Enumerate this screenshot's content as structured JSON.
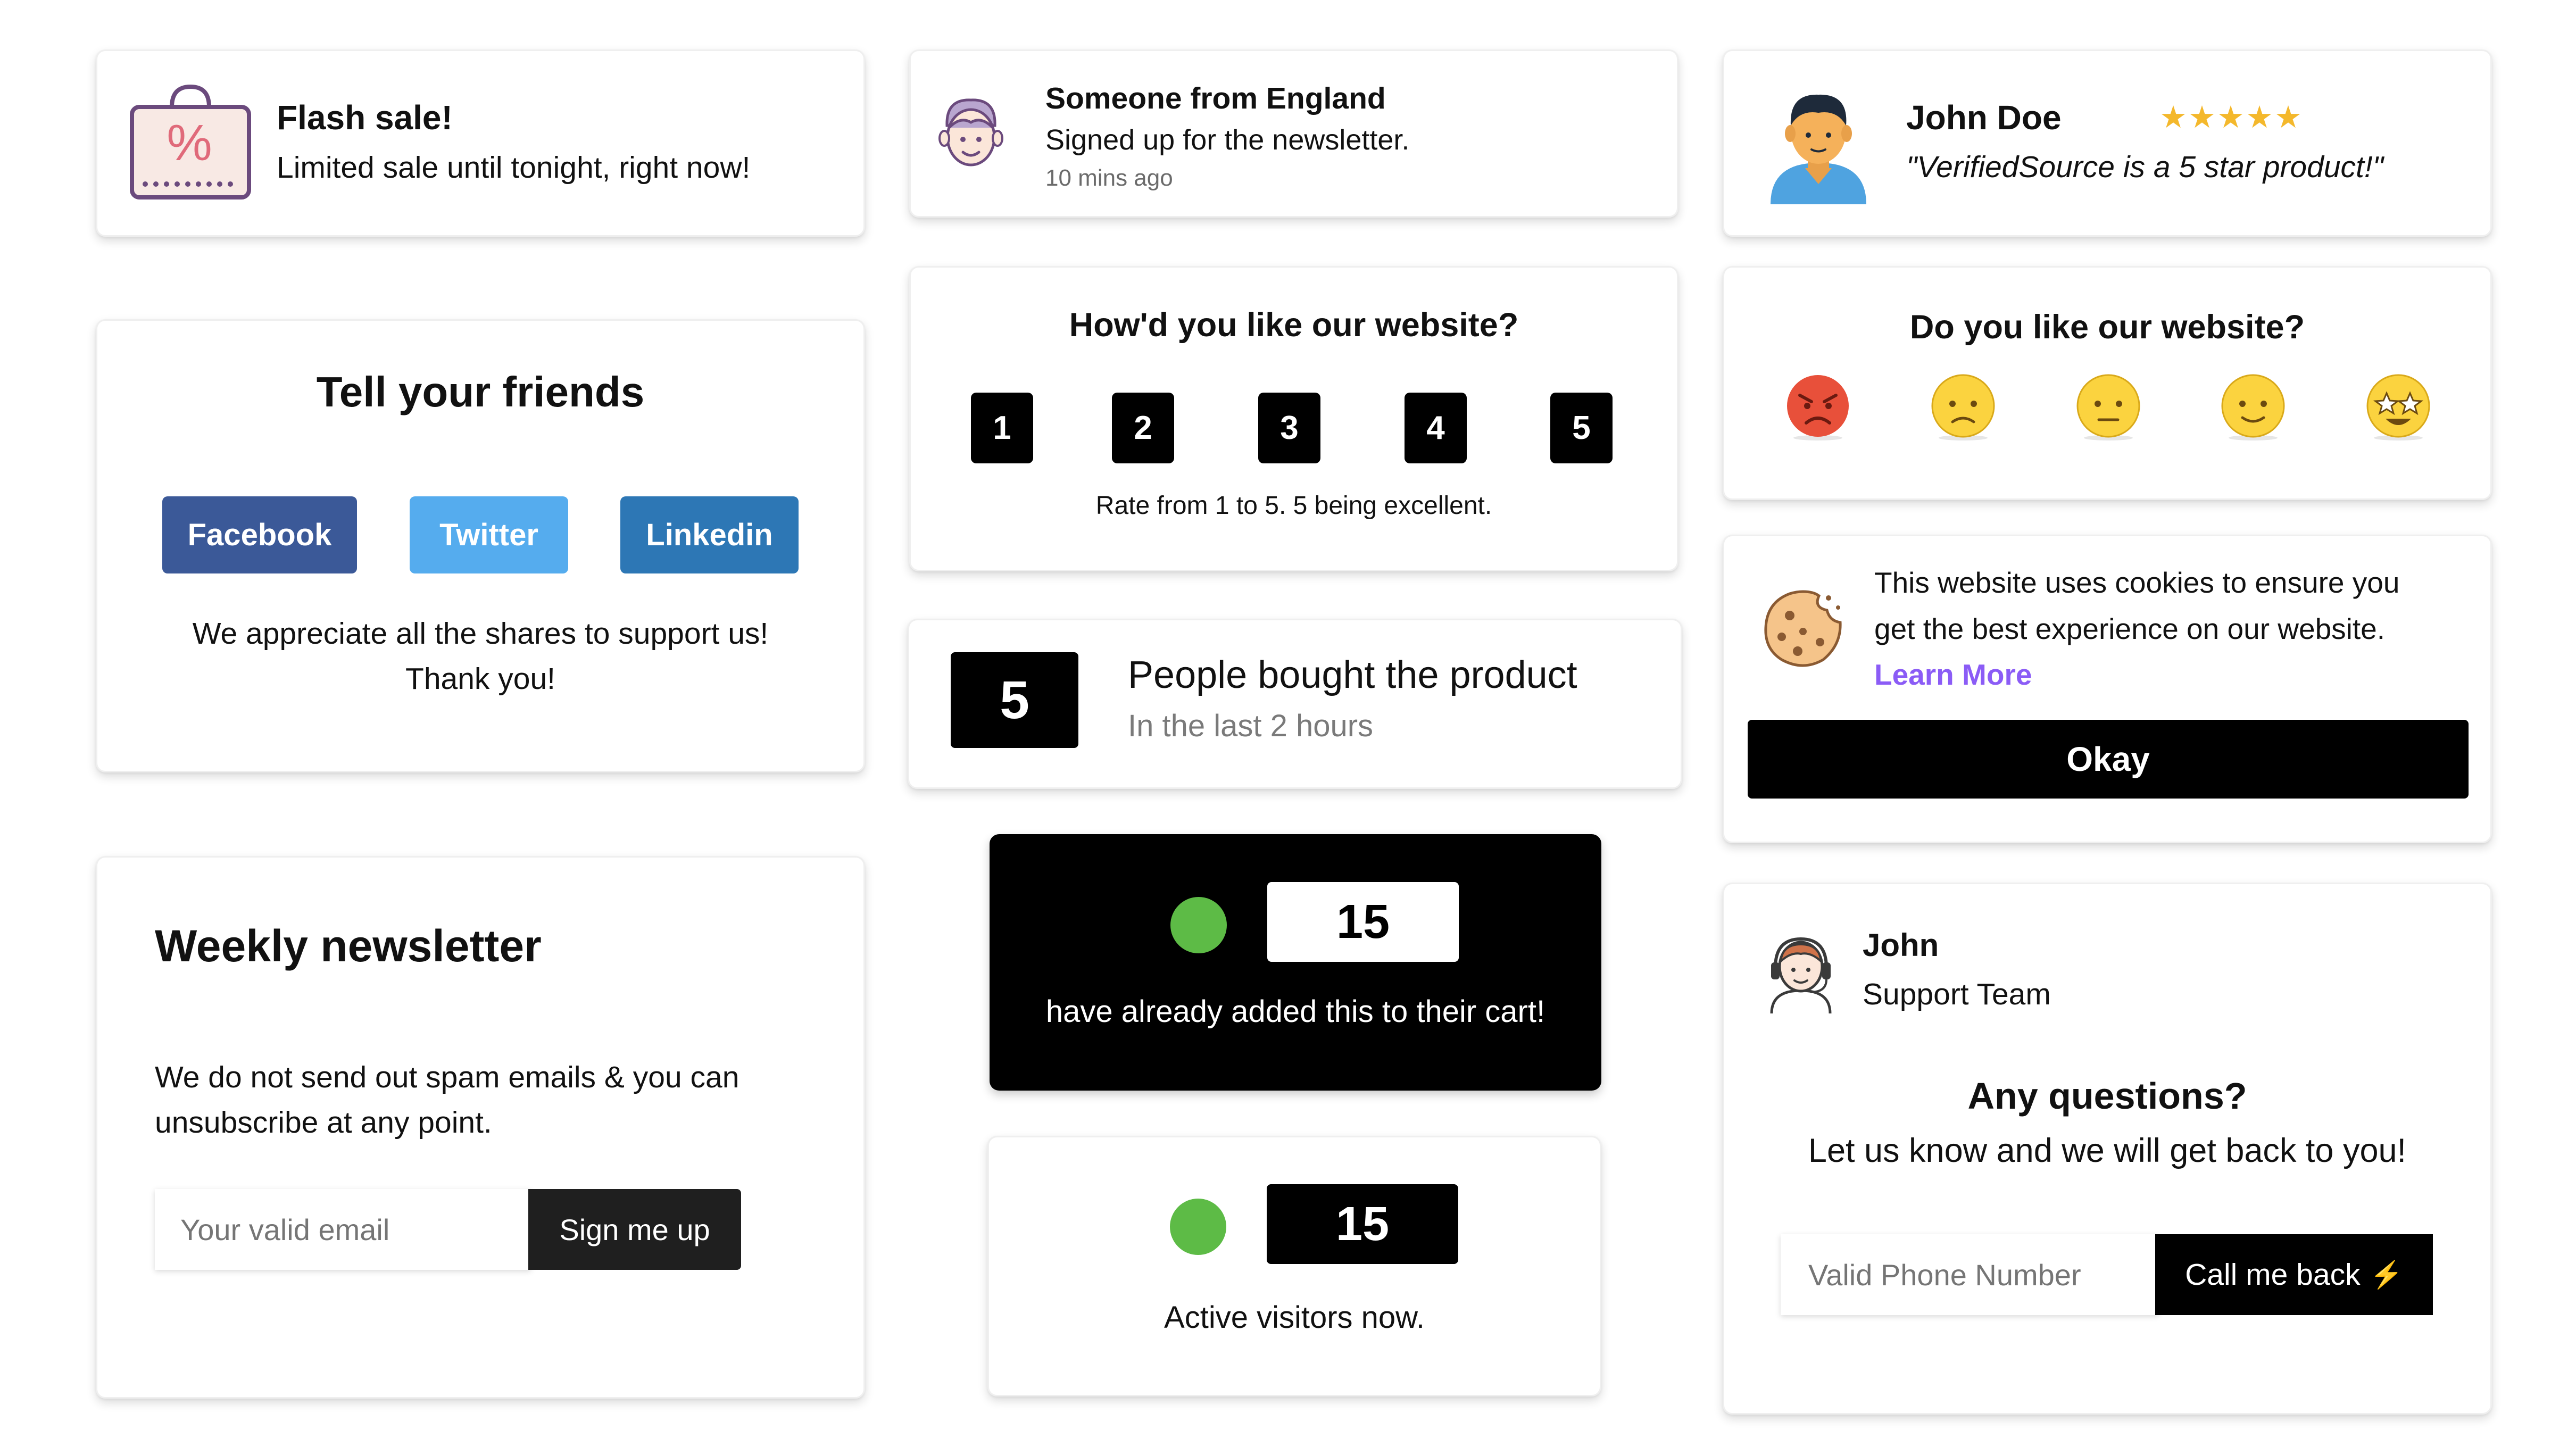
{
  "flash_sale": {
    "title": "Flash sale!",
    "text": "Limited sale until tonight, right now!"
  },
  "signup": {
    "name": "Someone from England",
    "text": "Signed up for the newsletter.",
    "time": "10 mins ago"
  },
  "review": {
    "name": "John Doe",
    "rating": 5,
    "stars": "★★★★★",
    "quote": "\"VerifiedSource is a 5 star product!\""
  },
  "share": {
    "title": "Tell your friends",
    "buttons": [
      {
        "label": "Facebook",
        "color": "#3b5998"
      },
      {
        "label": "Twitter",
        "color": "#55acee"
      },
      {
        "label": "Linkedin",
        "color": "#2d77b5"
      }
    ],
    "line1": "We appreciate all the shares to support us!",
    "line2": "Thank you!"
  },
  "rating": {
    "title": "How'd you like our website?",
    "options": [
      "1",
      "2",
      "3",
      "4",
      "5"
    ],
    "caption": "Rate from 1 to 5. 5 being excellent."
  },
  "mood": {
    "title": "Do you like our website?",
    "emojis": [
      "angry-face-icon",
      "sad-face-icon",
      "neutral-face-icon",
      "slight-smile-icon",
      "star-eyes-icon"
    ]
  },
  "purchases": {
    "count": "5",
    "title": "People bought the product",
    "subtitle": "In the last 2 hours"
  },
  "cookie": {
    "line1": "This website uses cookies to ensure you",
    "line2": "get the best experience on our website.",
    "link": "Learn More",
    "button": "Okay",
    "link_color": "#8b5cf6"
  },
  "cart": {
    "count": "15",
    "text": "have already added this to their cart!",
    "dot_color": "#5dbb46"
  },
  "visitors": {
    "count": "15",
    "text": "Active visitors now."
  },
  "newsletter": {
    "title": "Weekly newsletter",
    "line1": "We do not send out spam emails & you can",
    "line2": "unsubscribe at any point.",
    "placeholder": "Your valid email",
    "button": "Sign me up"
  },
  "support": {
    "name": "John",
    "team": "Support Team",
    "title": "Any questions?",
    "text": "Let us know and we will get back to you!",
    "placeholder": "Valid Phone Number",
    "button": "Call me back",
    "button_icon": "⚡"
  }
}
